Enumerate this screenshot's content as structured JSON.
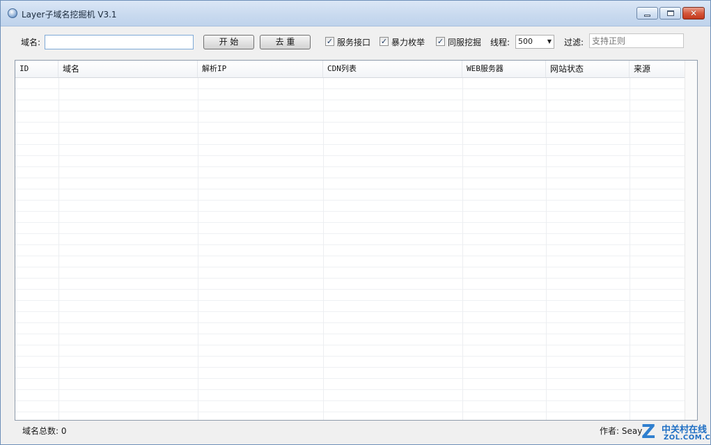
{
  "window": {
    "title": "Layer子域名挖掘机 V3.1",
    "controls": {
      "close_glyph": "✕"
    }
  },
  "toolbar": {
    "domain_label": "域名:",
    "domain_value": "",
    "start_button": "开 始",
    "dedupe_button": "去 重",
    "checkboxes": [
      {
        "label": "服务接口",
        "checked": true
      },
      {
        "label": "暴力枚举",
        "checked": true
      },
      {
        "label": "同服挖掘",
        "checked": true
      }
    ],
    "check_glyph": "✓",
    "threads_label": "线程:",
    "threads_value": "500",
    "threads_arrow": "▼",
    "filter_label": "过滤:",
    "filter_placeholder": "支持正则"
  },
  "table": {
    "columns": [
      "ID",
      "域名",
      "解析IP",
      "CDN列表",
      "WEB服务器",
      "网站状态",
      "来源"
    ],
    "rows": []
  },
  "status": {
    "total_label": "域名总数:",
    "total_value": "0",
    "author_label": "作者:",
    "author_value": "Seay"
  },
  "watermark": {
    "logo_letter": "Z",
    "name_cn": "中关村在线",
    "name_en": "ZOL.COM.CN"
  },
  "icons": [
    "app-icon",
    "minimize-icon",
    "maximize-icon",
    "close-icon",
    "dropdown-arrow-icon",
    "checkbox-check-icon"
  ],
  "colors": {
    "titlebar": "#c9daef",
    "close_button": "#d5573b",
    "input_focus_border": "#7ea9d6",
    "watermark": "#1f6fc4"
  }
}
